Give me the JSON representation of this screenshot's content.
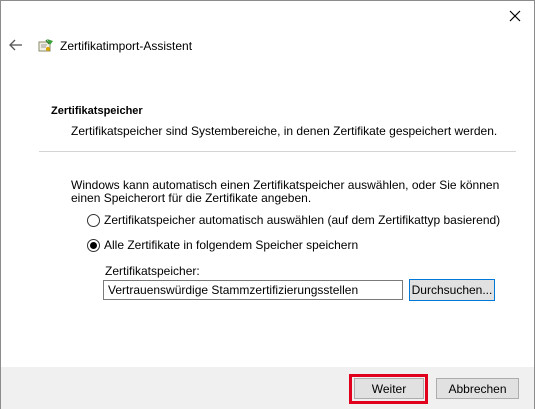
{
  "window": {
    "close_glyph": "✕"
  },
  "header": {
    "back_glyph": "←",
    "title": "Zertifikatimport-Assistent",
    "icon": "certificate-wizard-icon"
  },
  "section": {
    "title": "Zertifikatspeicher",
    "description": "Zertifikatspeicher sind Systembereiche, in denen Zertifikate gespeichert werden."
  },
  "main": {
    "intro": "Windows kann automatisch einen Zertifikatspeicher auswählen, oder Sie können einen Speicherort für die Zertifikate angeben.",
    "options": [
      {
        "label": "Zertifikatspeicher automatisch auswählen (auf dem Zertifikattyp basierend)",
        "selected": false
      },
      {
        "label": "Alle Zertifikate in folgendem Speicher speichern",
        "selected": true
      }
    ],
    "store_label": "Zertifikatspeicher:",
    "store_value": "Vertrauenswürdige Stammzertifizierungsstellen",
    "browse_label": "Durchsuchen..."
  },
  "footer": {
    "next_label": "Weiter",
    "cancel_label": "Abbrechen",
    "highlight_color": "#e0001b"
  }
}
